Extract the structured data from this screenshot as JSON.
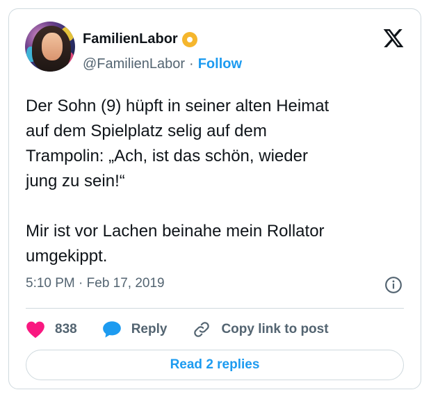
{
  "author": {
    "display_name": "FamilienLabor",
    "handle": "@FamilienLabor",
    "separator": "·",
    "follow_label": "Follow"
  },
  "tweet": {
    "text": "Der Sohn (9) hüpft in seiner alten Heimat\nauf dem Spielplatz selig auf dem\nTrampolin: „Ach, ist das schön, wieder\njung zu sein!“\n\nMir ist vor Lachen beinahe mein Rollator\numgekippt.",
    "timestamp": "5:10 PM · Feb 17, 2019"
  },
  "actions": {
    "likes_count": "838",
    "reply_label": "Reply",
    "copy_link_label": "Copy link to post"
  },
  "read_replies_label": "Read 2 replies",
  "icons": {
    "platform": "x-logo-icon",
    "badge": "radioactive-badge-icon",
    "info": "info-icon",
    "like": "heart-icon",
    "reply": "speech-bubble-icon",
    "copy_link": "link-icon"
  },
  "colors": {
    "accent": "#1d9bf0",
    "like": "#f91880",
    "muted": "#536471",
    "text": "#0f1419",
    "border": "#cfd9de"
  }
}
